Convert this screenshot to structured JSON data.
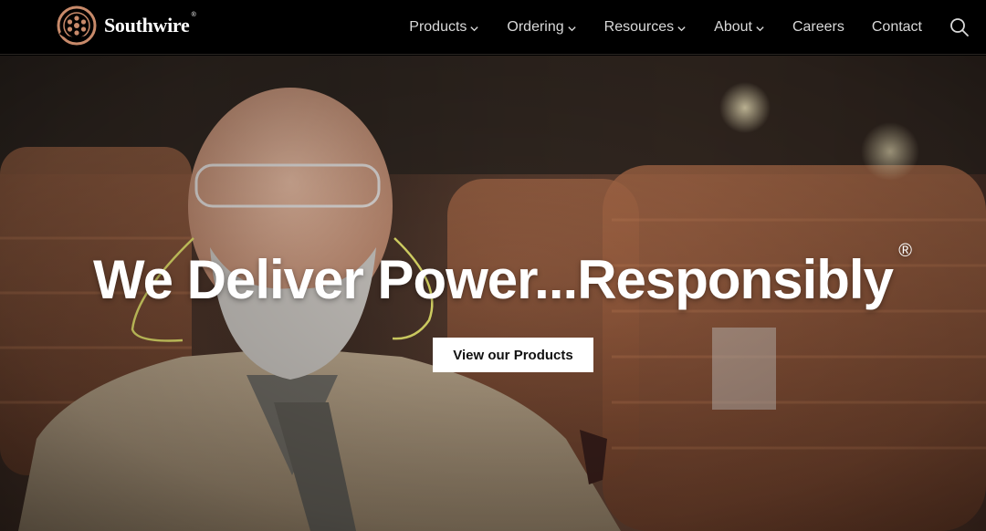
{
  "brand": {
    "name": "Southwire",
    "registered_mark": "®",
    "logo_icon": "southwire-logo-icon"
  },
  "nav": {
    "items": [
      {
        "label": "Products",
        "has_dropdown": true
      },
      {
        "label": "Ordering",
        "has_dropdown": true
      },
      {
        "label": "Resources",
        "has_dropdown": true
      },
      {
        "label": "About",
        "has_dropdown": true
      },
      {
        "label": "Careers",
        "has_dropdown": false
      },
      {
        "label": "Contact",
        "has_dropdown": false
      }
    ],
    "search_icon": "search-icon"
  },
  "hero": {
    "headline": "We Deliver Power...Responsibly",
    "registered_mark": "®",
    "cta_label": "View our Products",
    "image": "worker-with-copper-wire-spools"
  },
  "colors": {
    "header_bg": "#000000",
    "nav_text": "#d9d9d9",
    "headline": "#ffffff",
    "cta_bg": "#ffffff",
    "cta_text": "#111111",
    "logo_copper": "#c88a6a"
  }
}
